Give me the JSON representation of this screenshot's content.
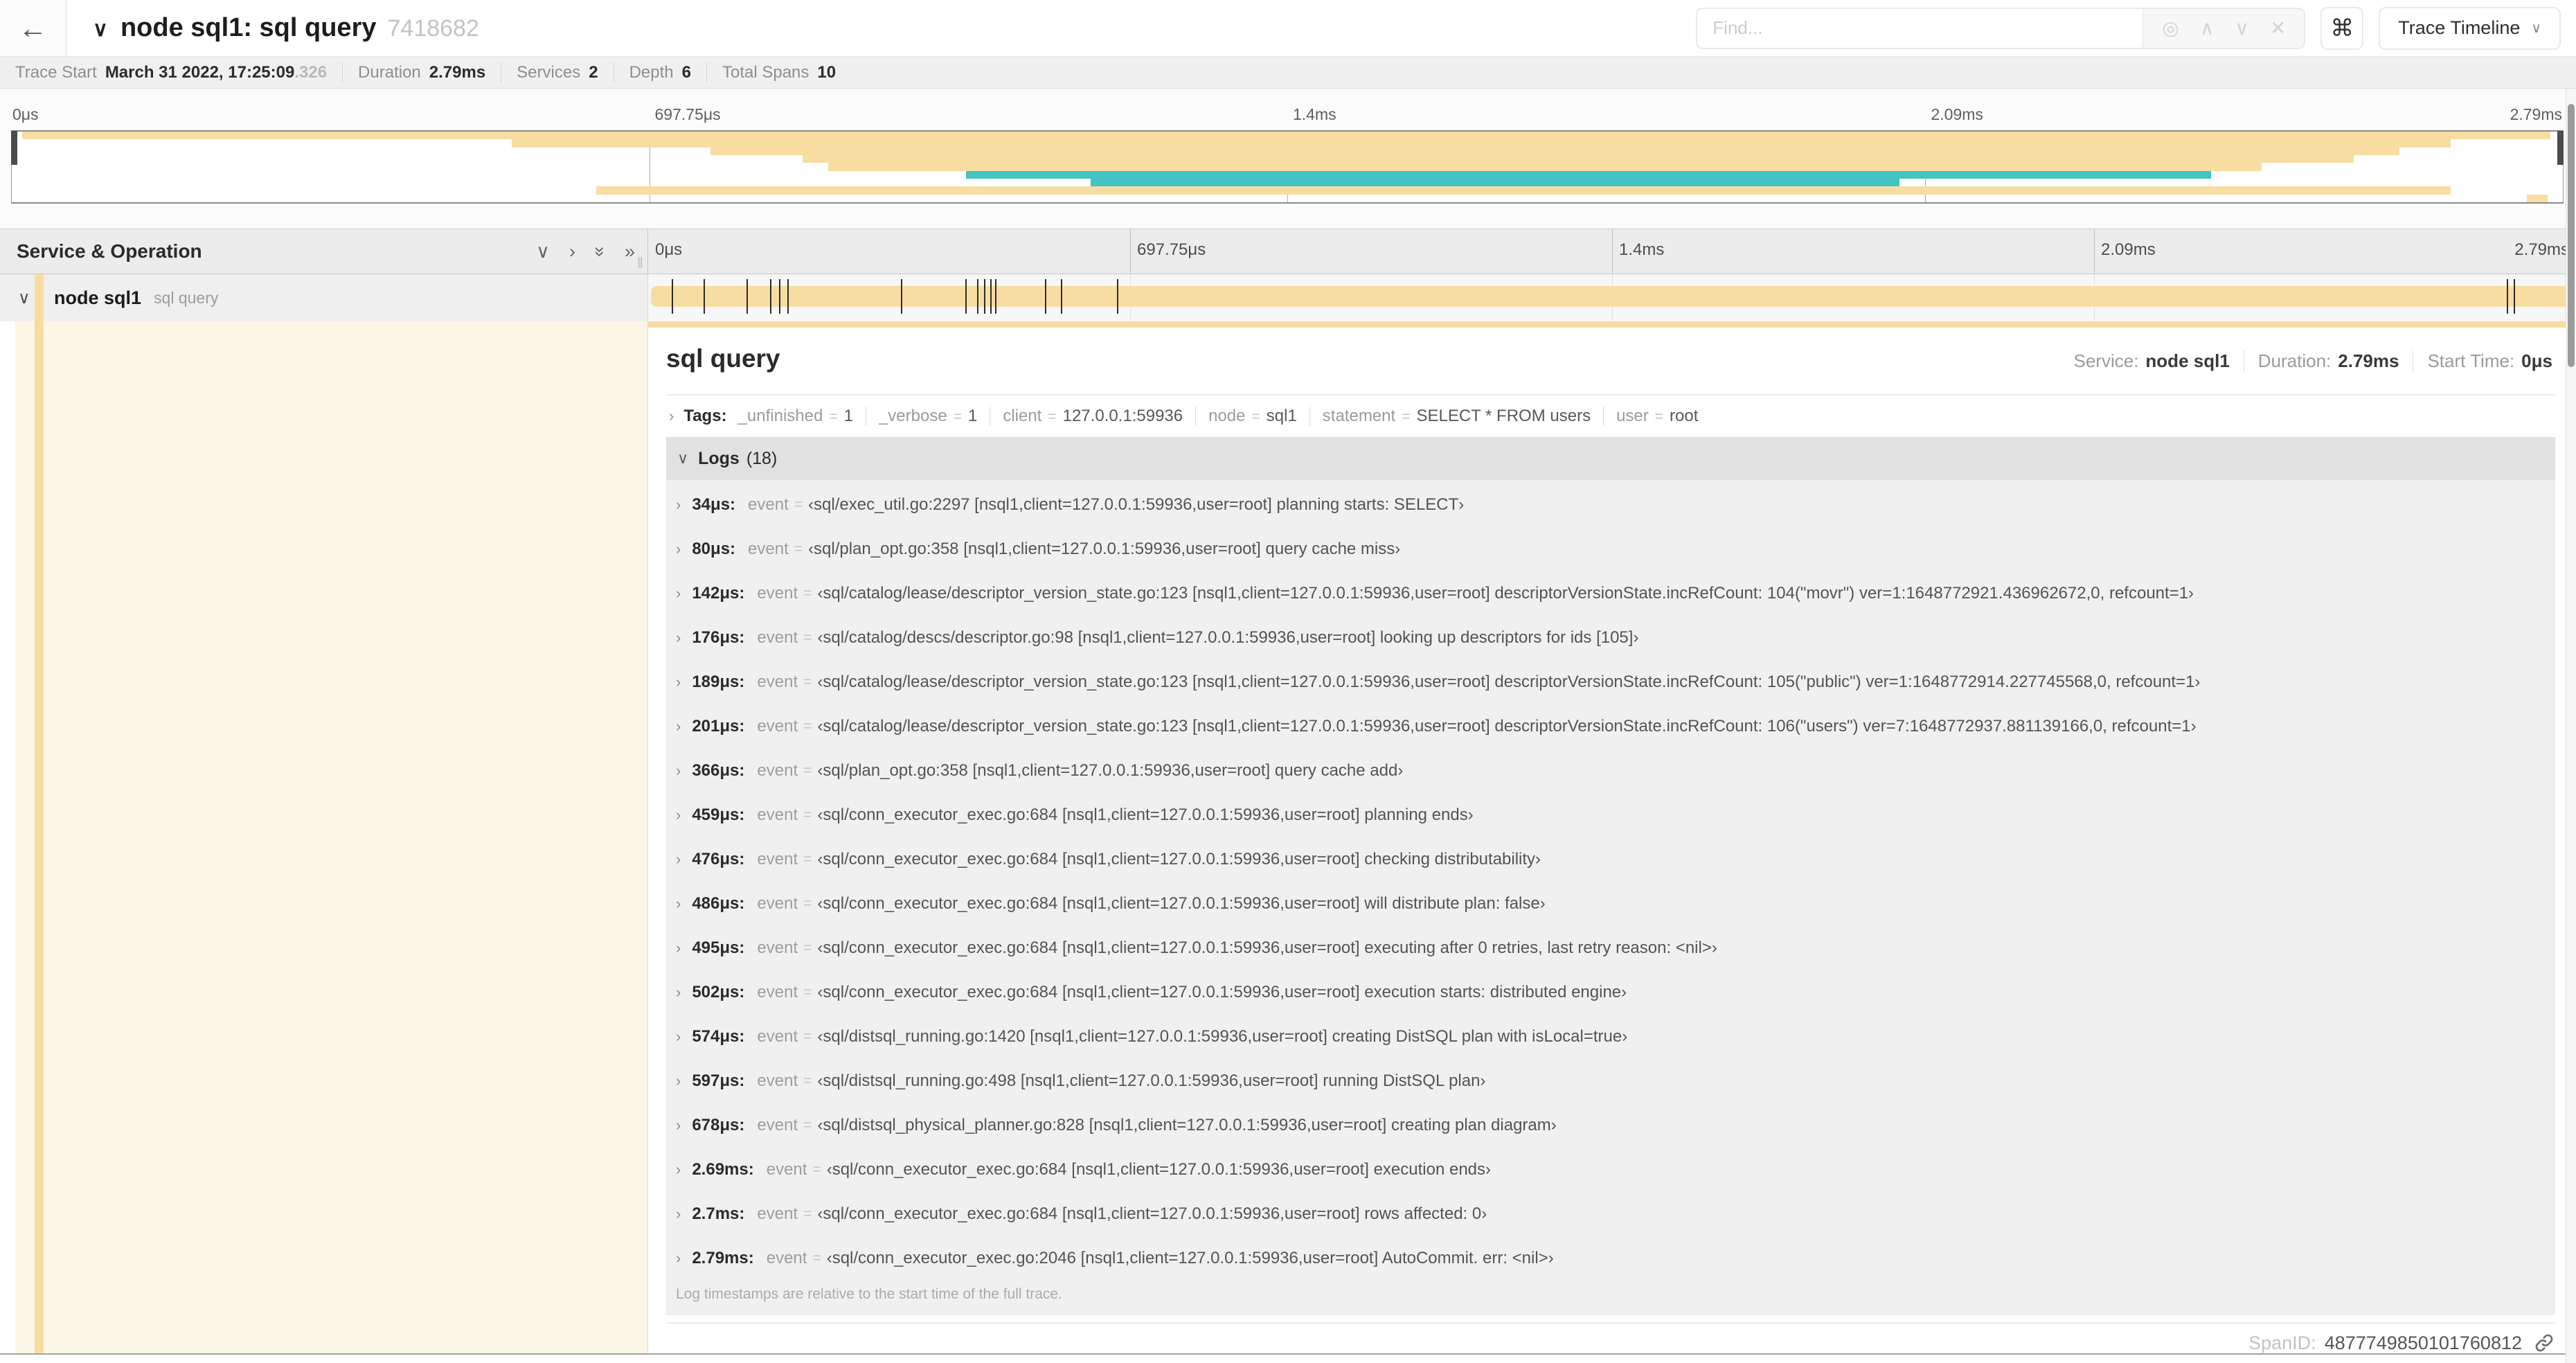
{
  "colors": {
    "tan": "#F8DDA2",
    "teal": "#41C4C3",
    "cream": "#FCF6E6"
  },
  "header": {
    "back_icon": "←",
    "collapse_icon": "∨",
    "title": "node sql1: sql query",
    "trace_id": "7418682",
    "find_placeholder": "Find...",
    "shortcut_icon": "⌘",
    "view_selector": "Trace Timeline",
    "view_selector_chevron": "∨"
  },
  "summary": {
    "items": [
      {
        "label": "Trace Start",
        "value": "March 31 2022, 17:25:09",
        "suffix": ".326"
      },
      {
        "label": "Duration",
        "value": "2.79ms",
        "suffix": ""
      },
      {
        "label": "Services",
        "value": "2",
        "suffix": ""
      },
      {
        "label": "Depth",
        "value": "6",
        "suffix": ""
      },
      {
        "label": "Total Spans",
        "value": "10",
        "suffix": ""
      }
    ]
  },
  "minimap": {
    "ticks": [
      "0μs",
      "697.75μs",
      "1.4ms",
      "2.09ms",
      "2.79ms"
    ],
    "bars": [
      {
        "start": 0.4,
        "end": 99.5,
        "color": "tan"
      },
      {
        "start": 19.6,
        "end": 95.6,
        "color": "tan"
      },
      {
        "start": 27.4,
        "end": 93.6,
        "color": "tan"
      },
      {
        "start": 31.0,
        "end": 91.8,
        "color": "tan"
      },
      {
        "start": 32.0,
        "end": 88.2,
        "color": "tan"
      },
      {
        "start": 37.4,
        "end": 86.2,
        "color": "teal"
      },
      {
        "start": 42.3,
        "end": 74.0,
        "color": "teal"
      },
      {
        "start": 22.9,
        "end": 95.6,
        "color": "tan"
      },
      {
        "start": 98.6,
        "end": 99.4,
        "color": "tan"
      }
    ]
  },
  "timeline": {
    "left_header": "Service & Operation",
    "total_us": 2790,
    "ruler_ticks": [
      "0μs",
      "697.75μs",
      "1.4ms",
      "2.09ms",
      "2.79ms"
    ],
    "span": {
      "service": "node sql1",
      "operation": "sql query"
    }
  },
  "detail": {
    "title": "sql query",
    "overview": [
      {
        "label": "Service:",
        "value": "node sql1"
      },
      {
        "label": "Duration:",
        "value": "2.79ms"
      },
      {
        "label": "Start Time:",
        "value": "0μs"
      }
    ],
    "tags_label": "Tags:",
    "tags": [
      {
        "key": "_unfinished",
        "value": "1"
      },
      {
        "key": "_verbose",
        "value": "1"
      },
      {
        "key": "client",
        "value": "127.0.0.1:59936"
      },
      {
        "key": "node",
        "value": "sql1"
      },
      {
        "key": "statement",
        "value": "SELECT * FROM users"
      },
      {
        "key": "user",
        "value": "root"
      }
    ],
    "logs": {
      "label": "Logs",
      "count": "(18)",
      "note": "Log timestamps are relative to the start time of the full trace.",
      "entries": [
        {
          "time": "34μs",
          "time_us": 34,
          "field": "event",
          "value": "sql/exec_util.go:2297 [nsql1,client=127.0.0.1:59936,user=root] planning starts: SELECT"
        },
        {
          "time": "80μs",
          "time_us": 80,
          "field": "event",
          "value": "sql/plan_opt.go:358 [nsql1,client=127.0.0.1:59936,user=root] query cache miss"
        },
        {
          "time": "142μs",
          "time_us": 142,
          "field": "event",
          "value": "sql/catalog/lease/descriptor_version_state.go:123 [nsql1,client=127.0.0.1:59936,user=root] descriptorVersionState.incRefCount: 104(\"movr\") ver=1:1648772921.436962672,0, refcount=1"
        },
        {
          "time": "176μs",
          "time_us": 176,
          "field": "event",
          "value": "sql/catalog/descs/descriptor.go:98 [nsql1,client=127.0.0.1:59936,user=root] looking up descriptors for ids [105]"
        },
        {
          "time": "189μs",
          "time_us": 189,
          "field": "event",
          "value": "sql/catalog/lease/descriptor_version_state.go:123 [nsql1,client=127.0.0.1:59936,user=root] descriptorVersionState.incRefCount: 105(\"public\") ver=1:1648772914.227745568,0, refcount=1"
        },
        {
          "time": "201μs",
          "time_us": 201,
          "field": "event",
          "value": "sql/catalog/lease/descriptor_version_state.go:123 [nsql1,client=127.0.0.1:59936,user=root] descriptorVersionState.incRefCount: 106(\"users\") ver=7:1648772937.881139166,0, refcount=1"
        },
        {
          "time": "366μs",
          "time_us": 366,
          "field": "event",
          "value": "sql/plan_opt.go:358 [nsql1,client=127.0.0.1:59936,user=root] query cache add"
        },
        {
          "time": "459μs",
          "time_us": 459,
          "field": "event",
          "value": "sql/conn_executor_exec.go:684 [nsql1,client=127.0.0.1:59936,user=root] planning ends"
        },
        {
          "time": "476μs",
          "time_us": 476,
          "field": "event",
          "value": "sql/conn_executor_exec.go:684 [nsql1,client=127.0.0.1:59936,user=root] checking distributability"
        },
        {
          "time": "486μs",
          "time_us": 486,
          "field": "event",
          "value": "sql/conn_executor_exec.go:684 [nsql1,client=127.0.0.1:59936,user=root] will distribute plan: false"
        },
        {
          "time": "495μs",
          "time_us": 495,
          "field": "event",
          "value": "sql/conn_executor_exec.go:684 [nsql1,client=127.0.0.1:59936,user=root] executing after 0 retries, last retry reason: <nil>"
        },
        {
          "time": "502μs",
          "time_us": 502,
          "field": "event",
          "value": "sql/conn_executor_exec.go:684 [nsql1,client=127.0.0.1:59936,user=root] execution starts: distributed engine"
        },
        {
          "time": "574μs",
          "time_us": 574,
          "field": "event",
          "value": "sql/distsql_running.go:1420 [nsql1,client=127.0.0.1:59936,user=root] creating DistSQL plan with isLocal=true"
        },
        {
          "time": "597μs",
          "time_us": 597,
          "field": "event",
          "value": "sql/distsql_running.go:498 [nsql1,client=127.0.0.1:59936,user=root] running DistSQL plan"
        },
        {
          "time": "678μs",
          "time_us": 678,
          "field": "event",
          "value": "sql/distsql_physical_planner.go:828 [nsql1,client=127.0.0.1:59936,user=root] creating plan diagram"
        },
        {
          "time": "2.69ms",
          "time_us": 2690,
          "field": "event",
          "value": "sql/conn_executor_exec.go:684 [nsql1,client=127.0.0.1:59936,user=root] execution ends"
        },
        {
          "time": "2.7ms",
          "time_us": 2700,
          "field": "event",
          "value": "sql/conn_executor_exec.go:684 [nsql1,client=127.0.0.1:59936,user=root] rows affected: 0"
        },
        {
          "time": "2.79ms",
          "time_us": 2790,
          "field": "event",
          "value": "sql/conn_executor_exec.go:2046 [nsql1,client=127.0.0.1:59936,user=root] AutoCommit. err: <nil>"
        }
      ]
    },
    "span_id_label": "SpanID:",
    "span_id": "4877749850101760812"
  }
}
